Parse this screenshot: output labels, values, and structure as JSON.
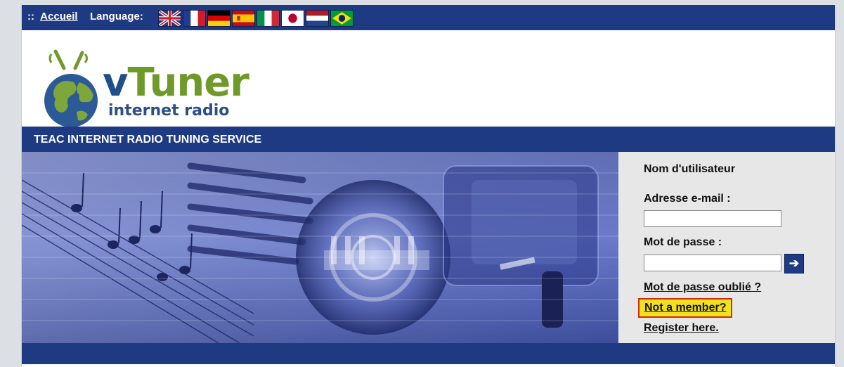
{
  "topbar": {
    "home_prefix": "::",
    "home_link": "Accueil",
    "language_label": "Language:"
  },
  "flags": [
    {
      "icon": "uk-flag-icon",
      "label": "English"
    },
    {
      "icon": "france-flag-icon",
      "label": "Français"
    },
    {
      "icon": "germany-flag-icon",
      "label": "Deutsch"
    },
    {
      "icon": "spain-flag-icon",
      "label": "Español"
    },
    {
      "icon": "italy-flag-icon",
      "label": "Italiano"
    },
    {
      "icon": "japan-flag-icon",
      "label": "日本語"
    },
    {
      "icon": "netherlands-flag-icon",
      "label": "Nederlands"
    },
    {
      "icon": "brazil-flag-icon",
      "label": "Português"
    }
  ],
  "logo": {
    "main_prefix": "v",
    "main_rest": "Tuner",
    "sub": "internet radio"
  },
  "service_bar": {
    "title": "TEAC INTERNET RADIO TUNING SERVICE"
  },
  "login": {
    "title": "Nom d'utilisateur",
    "email_label": "Adresse e-mail :",
    "email_value": "",
    "password_label": "Mot de passe :",
    "password_value": "",
    "forgot_link": "Mot de passe oublié ?",
    "member_link": "Not a member?",
    "register_link": "Register here."
  },
  "colors": {
    "header_blue": "#1d3a82",
    "logo_green": "#6f9a2a",
    "logo_blue": "#1f4f8a",
    "highlight_yellow": "#f2e21b",
    "highlight_border": "#cc2a1a"
  }
}
